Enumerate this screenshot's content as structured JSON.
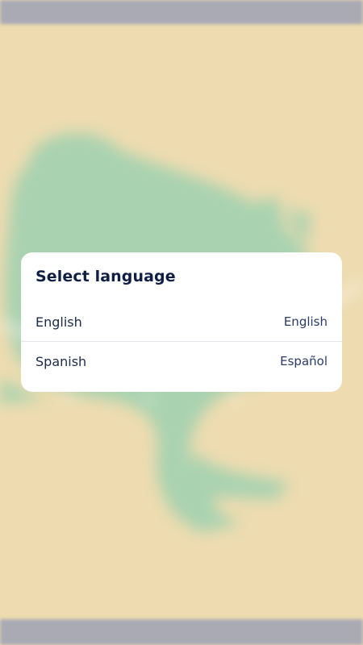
{
  "dialog": {
    "title": "Select language",
    "options": [
      {
        "label": "English",
        "native": "English"
      },
      {
        "label": "Spanish",
        "native": "Español"
      }
    ]
  },
  "colors": {
    "background": "#eedcb0",
    "frog": "#a9d2b0",
    "system_bars": "#a9aab4",
    "dialog": "#ffffff",
    "title_text": "#0f1f44",
    "divider": "#e2e4ea"
  },
  "background_art": "frog-illustration"
}
